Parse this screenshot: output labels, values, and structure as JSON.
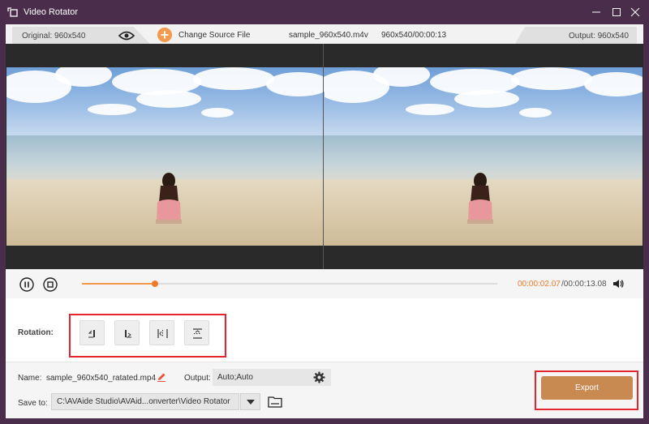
{
  "window": {
    "title": "Video Rotator",
    "icons": {
      "app": "rotate-icon",
      "minimize": "minimize-icon",
      "maximize": "maximize-icon",
      "close": "close-icon"
    }
  },
  "infobar": {
    "original": "Original: 960x540",
    "change_source": "Change Source File",
    "file_name": "sample_960x540.m4v",
    "file_info": "960x540/00:00:13",
    "output": "Output: 960x540"
  },
  "player": {
    "current_time": "00:00:02.07",
    "total_time": "/00:00:13.08",
    "progress": 0.176
  },
  "rotation": {
    "label": "Rotation:",
    "buttons": [
      "rotate-left-icon",
      "rotate-right-icon",
      "flip-horizontal-icon",
      "flip-vertical-icon"
    ]
  },
  "output_settings": {
    "name_label": "Name:",
    "name_value": "sample_960x540_ratated.mp4",
    "output_label": "Output:",
    "output_value": "Auto;Auto",
    "save_label": "Save to:",
    "save_path": "C:\\AVAide Studio\\AVAid...onverter\\Video Rotator",
    "export_label": "Export"
  },
  "colors": {
    "accent": "#f07a2c",
    "export": "#c98a52",
    "highlight": "#e3262d",
    "titlebar": "#4a2d4a"
  }
}
